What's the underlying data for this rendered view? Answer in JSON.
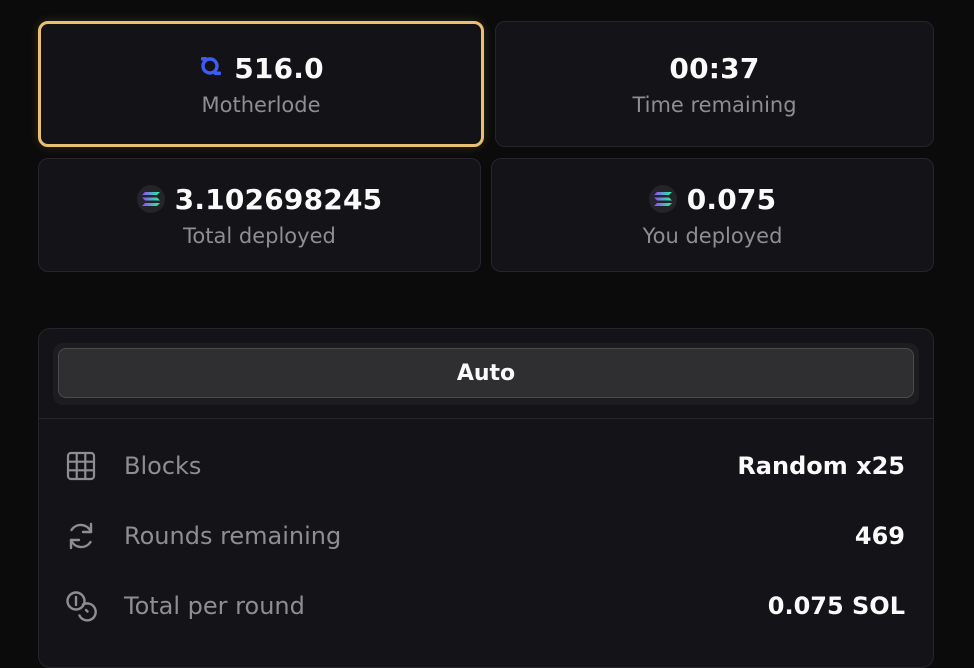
{
  "stats": {
    "motherlode": {
      "value": "516.0",
      "label": "Motherlode",
      "icon": "ore-icon"
    },
    "time": {
      "value": "00:37",
      "label": "Time remaining"
    },
    "total_deployed": {
      "value": "3.102698245",
      "label": "Total deployed",
      "icon": "sol-icon"
    },
    "you_deployed": {
      "value": "0.075",
      "label": "You deployed",
      "icon": "sol-icon"
    }
  },
  "panel": {
    "mode_label": "Auto",
    "rows": [
      {
        "icon": "grid-icon",
        "label": "Blocks",
        "value": "Random x25"
      },
      {
        "icon": "refresh-icon",
        "label": "Rounds remaining",
        "value": "469"
      },
      {
        "icon": "coins-icon",
        "label": "Total per round",
        "value": "0.075 SOL"
      }
    ]
  },
  "colors": {
    "highlight_border": "#e8c070",
    "ore_blue": "#3d5cf5",
    "sol_gradient": [
      "#9945ff",
      "#19fb9b"
    ]
  }
}
